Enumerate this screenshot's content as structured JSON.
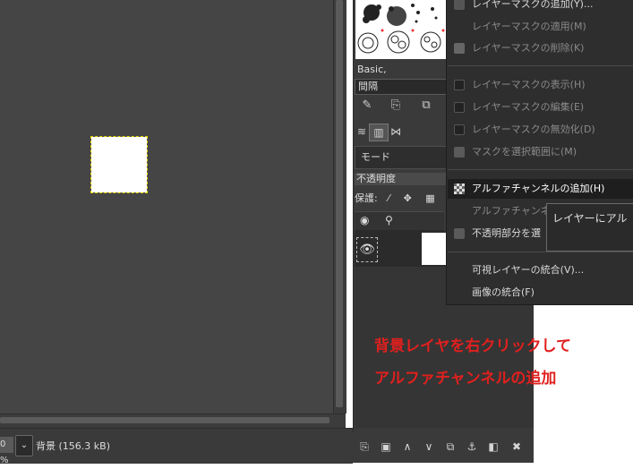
{
  "canvas": {
    "zoom_value": "0 %",
    "status_text": "背景 (156.3 kB)"
  },
  "dock": {
    "brush_name": "Basic,",
    "spacing_label": "間隔",
    "mode_label": "モード",
    "opacity_label": "不透明度",
    "lock_label": "保護:"
  },
  "context_menu": {
    "items": [
      {
        "label": "レイヤーマスクの追加(Y)...",
        "state": "enabled"
      },
      {
        "label": "レイヤーマスクの適用(M)",
        "state": "disabled"
      },
      {
        "label": "レイヤーマスクの削除(K)",
        "state": "disabled"
      },
      {
        "label": "レイヤーマスクの表示(H)",
        "state": "disabled"
      },
      {
        "label": "レイヤーマスクの編集(E)",
        "state": "disabled"
      },
      {
        "label": "レイヤーマスクの無効化(D)",
        "state": "disabled"
      },
      {
        "label": "マスクを選択範囲に(M)",
        "state": "disabled"
      },
      {
        "label": "アルファチャンネルの追加(H)",
        "state": "highlighted"
      },
      {
        "label": "アルファチャンネルの",
        "state": "disabled"
      },
      {
        "label": "不透明部分を選",
        "state": "enabled"
      },
      {
        "label": "可視レイヤーの統合(V)...",
        "state": "enabled"
      },
      {
        "label": "画像の統合(F)",
        "state": "enabled"
      }
    ]
  },
  "tooltip": {
    "text": "レイヤーにアル"
  },
  "annotation": {
    "line1": "背景レイヤを右クリックして",
    "line2": "アルファチャンネルの追加",
    "color": "#e0201e"
  }
}
